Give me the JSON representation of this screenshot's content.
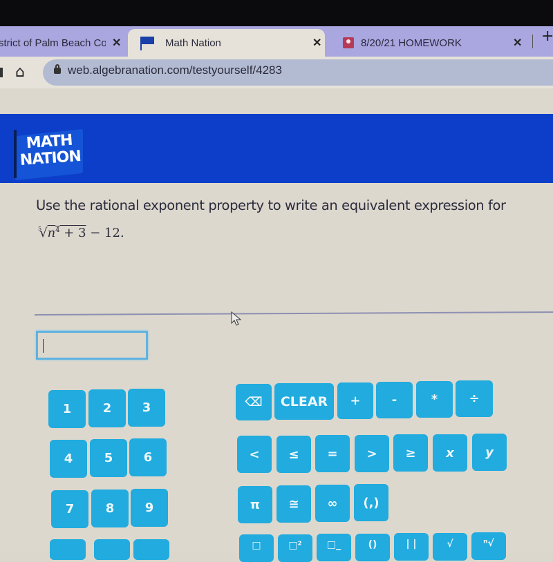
{
  "browser": {
    "tabs": [
      {
        "label": "strict of Palm Beach Cou",
        "icon": "none",
        "close": "✕"
      },
      {
        "label": "Math Nation",
        "icon": "flag-icon",
        "close": "✕"
      },
      {
        "label": "8/20/21 HOMEWORK",
        "icon": "google-classroom-icon",
        "close": "✕"
      }
    ],
    "new_tab": "+",
    "url": "web.algebranation.com/testyourself/4283"
  },
  "header": {
    "logo_line1": "MATH",
    "logo_line2": "NATION",
    "brand_color": "#0c3ec9"
  },
  "question": {
    "prompt": "Use the rational exponent property to write an equivalent expression for",
    "expression": {
      "root_index": "5",
      "radicand_base": "n",
      "radicand_exp": "4",
      "radicand_rest": " + 3",
      "tail": " − 12."
    }
  },
  "answer": {
    "value": "",
    "placeholder": ""
  },
  "keypad": {
    "key_color": "#21abde",
    "digits": [
      "1",
      "2",
      "3",
      "4",
      "5",
      "6",
      "7",
      "8",
      "9"
    ],
    "ops_row1": [
      "⌫",
      "CLEAR",
      "+",
      "-",
      "*",
      "÷"
    ],
    "ops_row2": [
      "<",
      "≤",
      "=",
      ">",
      "≥",
      "x",
      "y"
    ],
    "ops_row3": [
      "π",
      "≅",
      "∞",
      "(,)"
    ],
    "ops_row4": [
      "□",
      "□²",
      "□_",
      "()",
      "| |",
      "√",
      "ⁿ√"
    ]
  }
}
